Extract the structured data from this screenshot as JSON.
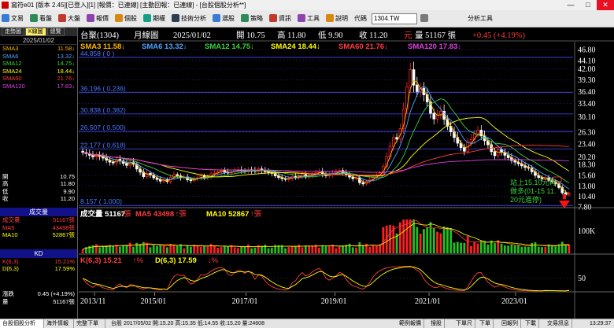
{
  "window": {
    "title": "窩符e01 [版本 2.45][已登入][1] [報價：已連線] [主動回報：已連線] - [台股個股分析**]",
    "minimize": "—",
    "maximize": "□",
    "close": "✕"
  },
  "toolbar": {
    "items": [
      "文易",
      "看盤",
      "大盤",
      "報價",
      "個股",
      "期權",
      "技術分析",
      "選股",
      "策略",
      "資訊",
      "工具",
      "說明"
    ],
    "code_label": "代碼",
    "code_value": "1304.TW",
    "analysis_tools": "分析工具",
    "icon_colors": [
      "#3a7bd5",
      "#2e8b57",
      "#c0392b",
      "#8e44ad",
      "#d68910",
      "#16a085",
      "#2c3e50"
    ]
  },
  "left_panel": {
    "tabs": [
      "走勢圖",
      "K線圖",
      "總覽"
    ],
    "active_tab": 1,
    "date": "2025/01/02",
    "ma_rows": [
      {
        "label": "SMA3",
        "value": "11.58",
        "color": "#ffb400",
        "arrow": "down"
      },
      {
        "label": "SMA6",
        "value": "13.32",
        "color": "#4fa3ff",
        "arrow": "down"
      },
      {
        "label": "SMA12",
        "value": "14.75",
        "color": "#3cd23c",
        "arrow": "down"
      },
      {
        "label": "SMA24",
        "value": "18.44",
        "color": "#ffff00",
        "arrow": "down"
      },
      {
        "label": "SMA60",
        "value": "21.76",
        "color": "#ff3c3c",
        "arrow": "down"
      },
      {
        "label": "SMA120",
        "value": "17.83",
        "color": "#e040e0",
        "arrow": "down"
      }
    ],
    "ohlc_rows": [
      {
        "label": "開",
        "value": "10.75"
      },
      {
        "label": "高",
        "value": "11.80"
      },
      {
        "label": "低",
        "value": "9.90"
      },
      {
        "label": "收",
        "value": "11.20"
      }
    ],
    "volume_header": "成交量",
    "volume_rows": [
      {
        "label": "成交量",
        "value": "51167張",
        "color": "#ff3c3c"
      },
      {
        "label": "MA5",
        "value": "43498張",
        "color": "#ff3c3c"
      },
      {
        "label": "MA10",
        "value": "52867張",
        "color": "#ffff00"
      }
    ],
    "kd_header": "KD",
    "kd_rows": [
      {
        "label": "K(6,3)",
        "value": "15.21%",
        "color": "#ff3c3c"
      },
      {
        "label": "D(6,3)",
        "value": "17.59%",
        "color": "#ffff00"
      }
    ],
    "change_rows": [
      {
        "label": "漲跌",
        "value": "0.45 (+4.19%)"
      },
      {
        "label": "量",
        "value": "51167張"
      }
    ]
  },
  "chart_header": {
    "name": "台聚(1304)",
    "period": "月線圖",
    "date": "2025/01/02",
    "open": "開 10.75",
    "high": "高 11.80",
    "low": "低 9.90",
    "close": "收 11.20",
    "unit": "元",
    "volume": "量 51167 張",
    "change": "+0.45 (+4.19%)"
  },
  "ma_legend": [
    {
      "label": "SMA3 11.58",
      "color": "#ffb400",
      "arrow": "↓"
    },
    {
      "label": "SMA6 13.32",
      "color": "#4fa3ff",
      "arrow": "↓"
    },
    {
      "label": "SMA12 14.75",
      "color": "#3cd23c",
      "arrow": "↓"
    },
    {
      "label": "SMA24 18.44",
      "color": "#ffff00",
      "arrow": "↓"
    },
    {
      "label": "SMA60 21.76",
      "color": "#ff3c3c",
      "arrow": "↓"
    },
    {
      "label": "SMA120 17.83",
      "color": "#e040e0",
      "arrow": "↓"
    }
  ],
  "fib_levels": [
    {
      "label": "44.858 ( 0 )",
      "price": 44.858
    },
    {
      "label": "36.196 ( 0.236)",
      "price": 36.196
    },
    {
      "label": "30.838 ( 0.382)",
      "price": 30.838
    },
    {
      "label": "26.507 ( 0.500)",
      "price": 26.507
    },
    {
      "label": "22.177 ( 0.618)",
      "price": 22.177
    },
    {
      "label": "8.157 ( 1.000)",
      "price": 8.157
    }
  ],
  "price_ticks": [
    "46.80",
    "44.10",
    "42.00",
    "39.30",
    "36.40",
    "33.40",
    "30.10",
    "26.30",
    "23.40",
    "20.20",
    "18.30",
    "15.60",
    "13.00",
    "10.40",
    "7.80"
  ],
  "annotation": [
    "站上15.10元再",
    "做多(01-15 11.",
    "20元進停)"
  ],
  "volume_legend": [
    {
      "label": "成交量 51167",
      "color": "#ffffff",
      "arrow": "↑張"
    },
    {
      "label": "MA5 43498",
      "color": "#ff3c3c",
      "arrow": "↑張"
    },
    {
      "label": "MA10 52867",
      "color": "#ffff00",
      "arrow": "↑張"
    }
  ],
  "volume_tick": "100K",
  "kd_legend": [
    {
      "label": "K(6,3) 15.21",
      "color": "#ff3c3c",
      "arrow": "↑%"
    },
    {
      "label": "D(6,3) 17.59",
      "color": "#ffff00",
      "arrow": "↓%"
    }
  ],
  "kd_tick": "50",
  "x_ticks": [
    "2013/11",
    "2015/01",
    "2017/01",
    "2019/01",
    "2021/01",
    "2023/01"
  ],
  "status_bar": {
    "tabs": [
      "台股個股分析",
      "海外情報",
      "完整下單"
    ],
    "info": "台股 2017/05/02 開:15.20 高:15.35 低:14.55 收:15.20 量:24608",
    "right_items": [
      "範例報價",
      "搜股",
      "下單尺",
      "下單",
      "回報列",
      "下載",
      "交易訊息"
    ],
    "clock": "13:29:37"
  },
  "chart_data": {
    "type": "candlestick",
    "title": "台聚(1304) 月線圖",
    "x_ticks": [
      "2013/11",
      "2015/01",
      "2017/01",
      "2019/01",
      "2021/01",
      "2023/01"
    ],
    "price_range": [
      7.8,
      46.8
    ],
    "candles_close": [
      21.3,
      21.0,
      20.6,
      20.2,
      20.7,
      20.3,
      19.9,
      19.4,
      18.9,
      18.7,
      19.6,
      19.2,
      18.6,
      18.1,
      18.9,
      18.4,
      17.2,
      16.4,
      15.3,
      16.1,
      15.7,
      15.0,
      14.6,
      14.2,
      14.5,
      14.1,
      15.1,
      15.8,
      15.5,
      15.0,
      15.2,
      14.5,
      14.3,
      14.8,
      15.0,
      15.5,
      15.0,
      15.3,
      16.0,
      16.2,
      16.5,
      16.8,
      16.4,
      16.2,
      16.5,
      16.9,
      17.0,
      16.8,
      16.6,
      17.0,
      16.8,
      16.6,
      17.2,
      16.9,
      16.5,
      16.3,
      16.1,
      15.5,
      15.1,
      14.8,
      14.6,
      14.9,
      15.3,
      15.0,
      15.4,
      15.8,
      15.2,
      15.6,
      15.9,
      16.3,
      16.6,
      15.9,
      15.5,
      15.8,
      16.2,
      16.4,
      16.8,
      16.3,
      15.8,
      15.2,
      14.8,
      15.0,
      13.8,
      13.5,
      14.1,
      14.6,
      15.2,
      15.6,
      16.2,
      17.8,
      20.3,
      22.8,
      25.0,
      24.6,
      27.2,
      32.0,
      37.5,
      41.8,
      38.0,
      36.4,
      37.2,
      35.6,
      33.8,
      31.0,
      29.6,
      30.8,
      31.5,
      29.5,
      27.8,
      26.4,
      25.0,
      23.6,
      22.5,
      21.6,
      23.8,
      24.5,
      25.9,
      26.8,
      25.4,
      24.2,
      23.2,
      21.5,
      20.5,
      22.0,
      21.4,
      20.6,
      20.0,
      19.3,
      18.9,
      18.5,
      18.0,
      17.6,
      17.4,
      16.5,
      15.6,
      15.1,
      14.8,
      15.0,
      14.4,
      14.1,
      13.5,
      12.6,
      11.3,
      10.75,
      11.2
    ],
    "volume_ma": [
      52867,
      43498
    ],
    "current_volume": 51167,
    "kd": {
      "K": 15.21,
      "D": 17.59
    },
    "fib_retracement": [
      {
        "ratio": 0,
        "price": 44.858
      },
      {
        "ratio": 0.236,
        "price": 36.196
      },
      {
        "ratio": 0.382,
        "price": 30.838
      },
      {
        "ratio": 0.5,
        "price": 26.507
      },
      {
        "ratio": 0.618,
        "price": 22.177
      },
      {
        "ratio": 1.0,
        "price": 8.157
      }
    ]
  }
}
